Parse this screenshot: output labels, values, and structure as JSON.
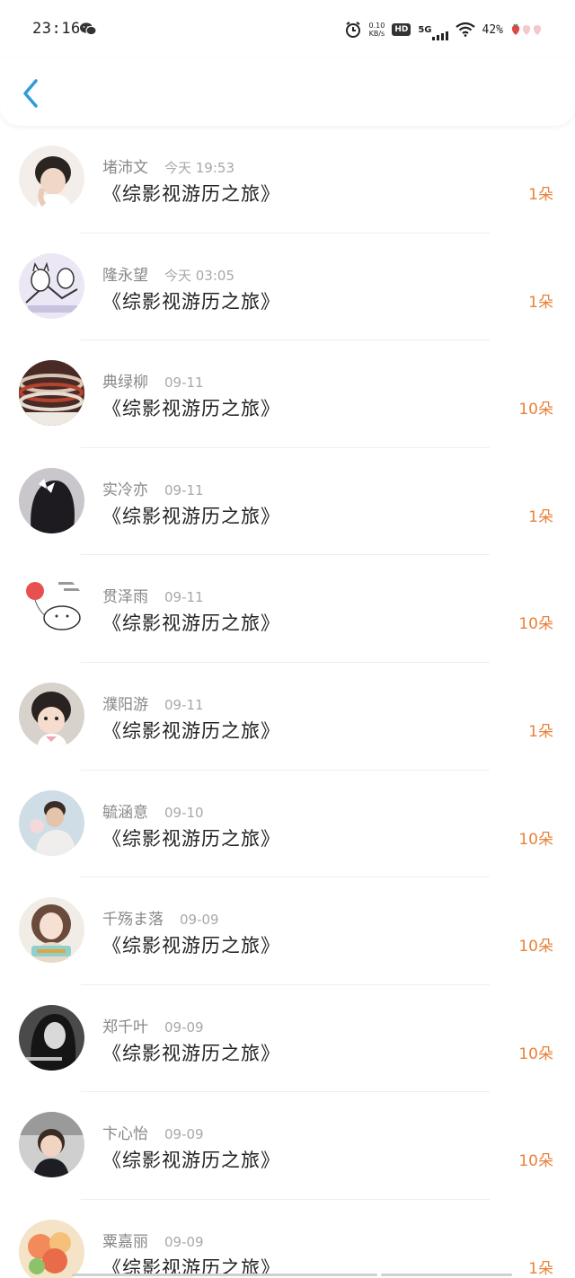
{
  "status_bar": {
    "time": "23:16",
    "net_speed_value": "0.10",
    "net_speed_unit": "KB/s",
    "hd_label": "HD",
    "network_label": "5G",
    "battery_percent": "42%"
  },
  "header": {
    "back_icon": "chevron-left-icon",
    "accent_color": "#2f9bdc"
  },
  "colors": {
    "flower_count": "#e8823a",
    "name": "#888888",
    "title": "#222222"
  },
  "records": [
    {
      "name": "堵沛文",
      "time": "今天 19:53",
      "title": "《综影视游历之旅》",
      "count": "1朵"
    },
    {
      "name": "隆永望",
      "time": "今天 03:05",
      "title": "《综影视游历之旅》",
      "count": "1朵"
    },
    {
      "name": "典绿柳",
      "time": "09-11",
      "title": "《综影视游历之旅》",
      "count": "10朵"
    },
    {
      "name": "实冷亦",
      "time": "09-11",
      "title": "《综影视游历之旅》",
      "count": "1朵"
    },
    {
      "name": "贯泽雨",
      "time": "09-11",
      "title": "《综影视游历之旅》",
      "count": "10朵"
    },
    {
      "name": "濮阳游",
      "time": "09-11",
      "title": "《综影视游历之旅》",
      "count": "1朵"
    },
    {
      "name": "毓涵意",
      "time": "09-10",
      "title": "《综影视游历之旅》",
      "count": "10朵"
    },
    {
      "name": "千殇ま落",
      "time": "09-09",
      "title": "《综影视游历之旅》",
      "count": "10朵"
    },
    {
      "name": "郑千叶",
      "time": "09-09",
      "title": "《综影视游历之旅》",
      "count": "10朵"
    },
    {
      "name": "卞心怡",
      "time": "09-09",
      "title": "《综影视游历之旅》",
      "count": "10朵"
    },
    {
      "name": "粟嘉丽",
      "time": "09-09",
      "title": "《综影视游历之旅》",
      "count": "1朵"
    }
  ]
}
